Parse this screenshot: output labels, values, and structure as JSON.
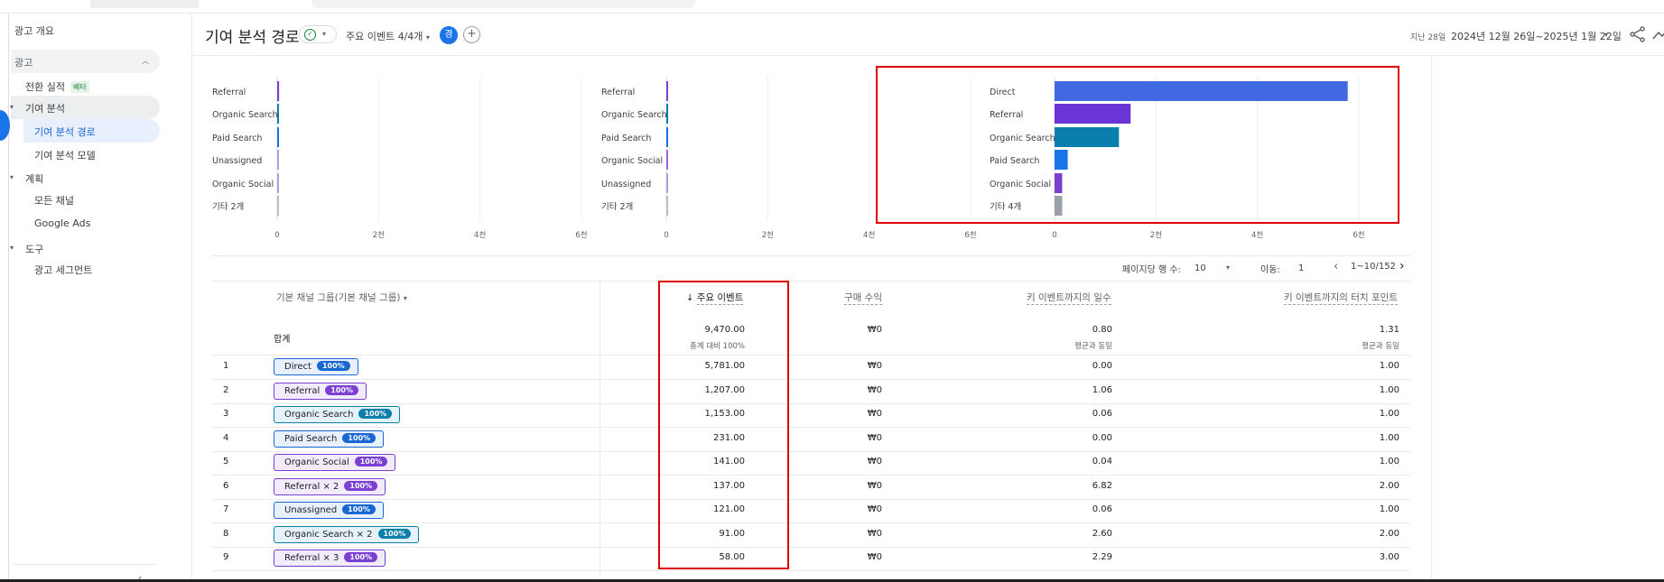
{
  "sidebar": {
    "overview": "광고 개요",
    "section_ads": "광고",
    "conversions": "전환 실적",
    "beta": "베타",
    "attribution": "기여 분석",
    "attribution_paths": "기여 분석 경로",
    "attribution_models": "기여 분석 모델",
    "planning": "계획",
    "all_channels": "모든 채널",
    "google_ads": "Google Ads",
    "tools": "도구",
    "ad_segments": "광고 세그먼트"
  },
  "header": {
    "title": "기여 분석 경로",
    "events_dropdown": "주요 이벤트 4/4개",
    "user_initial": "경",
    "add": "+",
    "range_label": "지난 28일",
    "range_dates": "2024년 12월 26일~2025년 1월 22일"
  },
  "charts": [
    {
      "labels": [
        "Referral",
        "Organic Search",
        "Paid Search",
        "Unassigned",
        "Organic Social",
        "기타 2개"
      ],
      "values": [
        38,
        30,
        10,
        4,
        4,
        3
      ],
      "colors": [
        "#7b3fd3",
        "#0b7fab",
        "#1a73e8",
        "#b39ddb",
        "#b39ddb",
        "#bdbdbd"
      ],
      "ticks": [
        "0",
        "2천",
        "4천",
        "6천"
      ]
    },
    {
      "labels": [
        "Referral",
        "Organic Search",
        "Paid Search",
        "Organic Social",
        "Unassigned",
        "기타 2개"
      ],
      "values": [
        25,
        20,
        8,
        5,
        4,
        3
      ],
      "colors": [
        "#7b3fd3",
        "#0b7fab",
        "#1a73e8",
        "#9c6ade",
        "#b39ddb",
        "#bdbdbd"
      ],
      "ticks": [
        "0",
        "2천",
        "4천",
        "6천"
      ]
    },
    {
      "labels": [
        "Direct",
        "Referral",
        "Organic Search",
        "Paid Search",
        "Organic Social",
        "기타 4개"
      ],
      "values": [
        5781,
        1500,
        1270,
        260,
        150,
        150
      ],
      "colors": [
        "#4169e1",
        "#6a35d6",
        "#0b7fab",
        "#1a73e8",
        "#7b3fd3",
        "#9aa0a6"
      ],
      "ticks": [
        "0",
        "2천",
        "4천",
        "6천"
      ]
    }
  ],
  "pager": {
    "rows_label": "페이지당 행 수:",
    "rows_value": "10",
    "goto_label": "이동:",
    "goto_value": "1",
    "range": "1~10/152"
  },
  "table": {
    "dimension_header": "기본 채널 그룹(기본 채널 그룹)",
    "headers": [
      "주요 이벤트",
      "구매 수익",
      "키 이벤트까지의 일수",
      "키 이벤트까지의 터치 포인트"
    ],
    "total_label": "합계",
    "totals": [
      "9,470.00",
      "₩0",
      "0.80",
      "1.31"
    ],
    "totals_sub": [
      "총계 대비 100%",
      "",
      "평균과 동일",
      "평균과 동일"
    ],
    "rows": [
      {
        "n": "1",
        "channel": "Direct",
        "pct": "100%",
        "c": "blue",
        "events": "5,781.00",
        "revenue": "₩0",
        "days": "0.00",
        "touch": "1.00"
      },
      {
        "n": "2",
        "channel": "Referral",
        "pct": "100%",
        "c": "purple",
        "events": "1,207.00",
        "revenue": "₩0",
        "days": "1.06",
        "touch": "1.00"
      },
      {
        "n": "3",
        "channel": "Organic Search",
        "pct": "100%",
        "c": "teal",
        "events": "1,153.00",
        "revenue": "₩0",
        "days": "0.06",
        "touch": "1.00"
      },
      {
        "n": "4",
        "channel": "Paid Search",
        "pct": "100%",
        "c": "blue",
        "events": "231.00",
        "revenue": "₩0",
        "days": "0.00",
        "touch": "1.00"
      },
      {
        "n": "5",
        "channel": "Organic Social",
        "pct": "100%",
        "c": "purple",
        "events": "141.00",
        "revenue": "₩0",
        "days": "0.04",
        "touch": "1.00"
      },
      {
        "n": "6",
        "channel": "Referral × 2",
        "pct": "100%",
        "c": "purple",
        "events": "137.00",
        "revenue": "₩0",
        "days": "6.82",
        "touch": "2.00"
      },
      {
        "n": "7",
        "channel": "Unassigned",
        "pct": "100%",
        "c": "blue",
        "events": "121.00",
        "revenue": "₩0",
        "days": "0.06",
        "touch": "1.00"
      },
      {
        "n": "8",
        "channel": "Organic Search × 2",
        "pct": "100%",
        "c": "teal",
        "events": "91.00",
        "revenue": "₩0",
        "days": "2.60",
        "touch": "2.00"
      },
      {
        "n": "9",
        "channel": "Referral × 3",
        "pct": "100%",
        "c": "purple",
        "events": "58.00",
        "revenue": "₩0",
        "days": "2.29",
        "touch": "3.00"
      }
    ]
  }
}
